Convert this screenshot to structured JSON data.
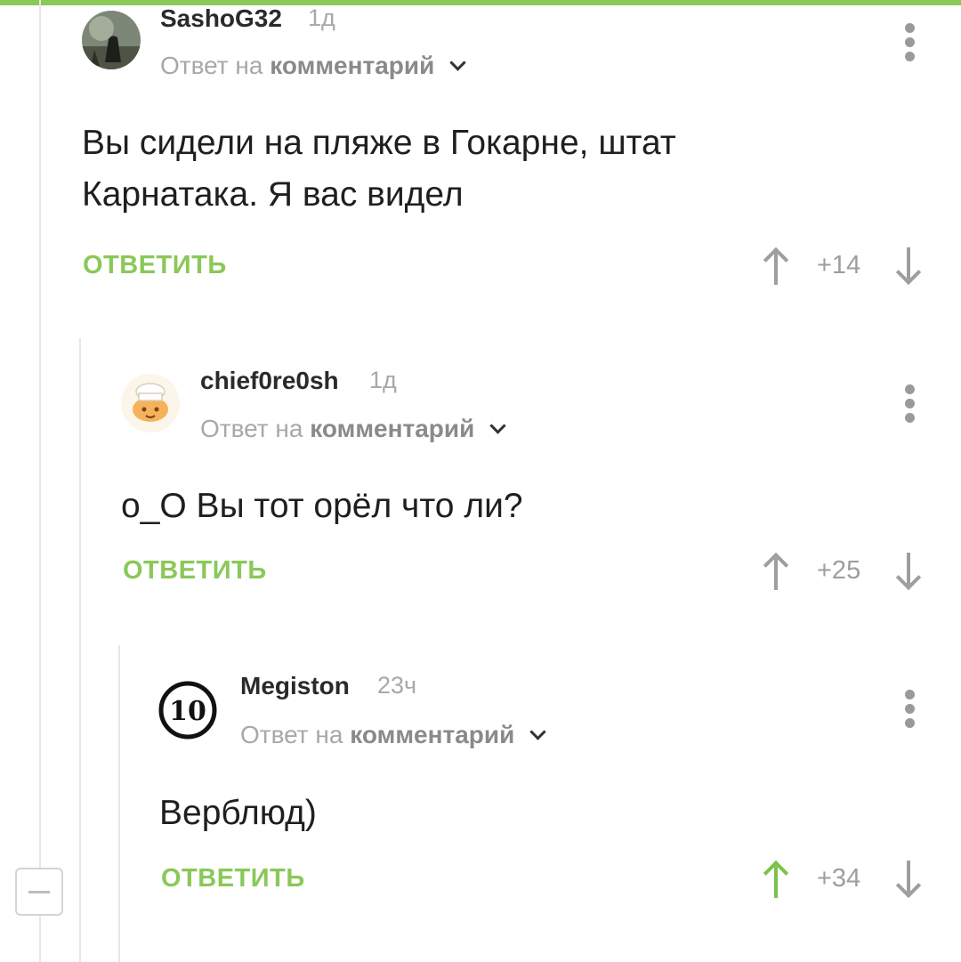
{
  "comments": [
    {
      "username": "SashoG32",
      "time": "1д",
      "reply_prefix": "Ответ на",
      "reply_target": "комментарий",
      "text": "Вы сидели на пляже в Гокарне, штат Карнатака. Я вас видел",
      "reply_label": "ОТВЕТИТЬ",
      "score": "+14",
      "upvoted": false
    },
    {
      "username": "chief0re0sh",
      "time": "1д",
      "reply_prefix": "Ответ на",
      "reply_target": "комментарий",
      "text": "o_O Вы тот орёл что ли?",
      "reply_label": "ОТВЕТИТЬ",
      "score": "+25",
      "upvoted": false
    },
    {
      "username": "Megiston",
      "time": "23ч",
      "avatar_text": "10",
      "reply_prefix": "Ответ на",
      "reply_target": "комментарий",
      "text": "Верблюд)",
      "reply_label": "ОТВЕТИТЬ",
      "score": "+34",
      "upvoted": true
    }
  ],
  "colors": {
    "accent": "#8ac858",
    "upvote_active": "#7cc24a",
    "muted": "#a8a8a8"
  },
  "icons": {
    "menu": "more-vertical-icon",
    "upvote": "arrow-up-icon",
    "downvote": "arrow-down-icon",
    "collapse": "minus-icon"
  }
}
